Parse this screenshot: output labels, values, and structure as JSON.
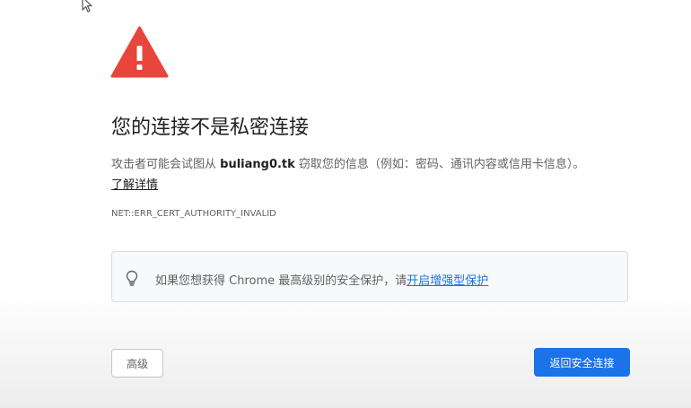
{
  "interstitial": {
    "title": "您的连接不是私密连接",
    "description_prefix": "攻击者可能会试图从 ",
    "hostname": "buliang0.tk",
    "description_suffix": " 窃取您的信息（例如：密码、通讯内容或信用卡信息）。",
    "learn_more": "了解详情",
    "error_code": "NET::ERR_CERT_AUTHORITY_INVALID"
  },
  "enhanced_protection": {
    "text": "如果您想获得 Chrome 最高级别的安全保护，请",
    "link": "开启增强型保护"
  },
  "buttons": {
    "advanced": "高级",
    "back_to_safety": "返回安全连接"
  },
  "colors": {
    "warning_red": "#e8453c",
    "primary_blue": "#1a73e8"
  },
  "icons": {
    "warning": "warning-triangle-icon",
    "lightbulb": "lightbulb-icon",
    "cursor": "mouse-cursor-icon"
  }
}
